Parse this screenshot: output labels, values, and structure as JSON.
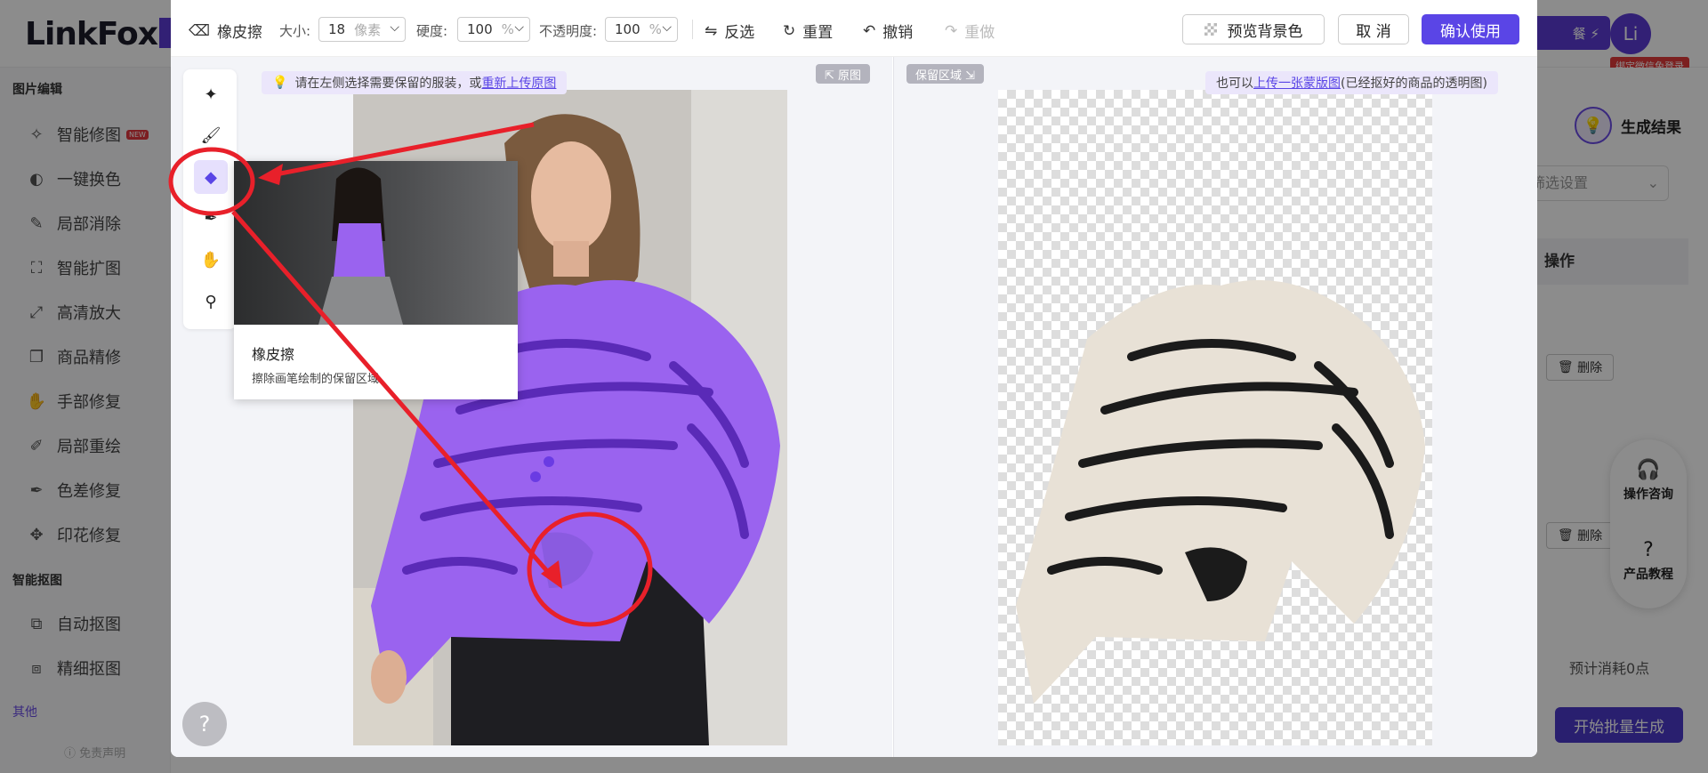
{
  "app": {
    "logo_text": "LinkFox"
  },
  "sidebar": {
    "sections": [
      {
        "title": "图片编辑",
        "items": [
          {
            "label": "智能修图",
            "icon": "magic-wand-icon",
            "badge": "NEW"
          },
          {
            "label": "一键换色",
            "icon": "color-swap-icon"
          },
          {
            "label": "局部消除",
            "icon": "eraser-icon"
          },
          {
            "label": "智能扩图",
            "icon": "expand-icon"
          },
          {
            "label": "高清放大",
            "icon": "upscale-icon"
          },
          {
            "label": "商品精修",
            "icon": "refine-icon"
          },
          {
            "label": "手部修复",
            "icon": "hand-icon"
          },
          {
            "label": "局部重绘",
            "icon": "redraw-icon"
          },
          {
            "label": "色差修复",
            "icon": "color-fix-icon"
          },
          {
            "label": "印花修复",
            "icon": "print-fix-icon"
          }
        ]
      },
      {
        "title": "智能抠图",
        "items": [
          {
            "label": "自动抠图",
            "icon": "auto-cutout-icon"
          },
          {
            "label": "精细抠图",
            "icon": "fine-cutout-icon"
          }
        ]
      },
      {
        "title": "其他",
        "items": []
      }
    ],
    "free_note": "免责声明"
  },
  "header": {
    "package_label": "餐 ⚡",
    "avatar_initial": "Li",
    "bind_tag": "绑定微信免登录"
  },
  "right_panel": {
    "gen_title": "生成结果",
    "filter_placeholder": "筛选设置",
    "op_header": "操作",
    "delete_label": "删除",
    "estimate": "预计消耗0点",
    "batch_button": "开始批量生成",
    "float": {
      "consult": "操作咨询",
      "tutorial": "产品教程"
    }
  },
  "modal": {
    "toolbar": {
      "tool_name": "橡皮擦",
      "size_label": "大小:",
      "size_value": "18",
      "size_unit": "像素",
      "hardness_label": "硬度:",
      "hardness_value": "100",
      "hardness_unit": "%",
      "opacity_label": "不透明度:",
      "opacity_value": "100",
      "opacity_unit": "%",
      "invert": "反选",
      "reset": "重置",
      "undo": "撤销",
      "redo": "重做",
      "preview_bg": "预览背景色",
      "cancel": "取 消",
      "confirm": "确认使用"
    },
    "hint_left": "请在左侧选择需要保留的服装，或 ",
    "hint_left_link": "重新上传原图",
    "hint_right": "也可以 ",
    "hint_right_link": "上传一张蒙版图",
    "hint_right_suffix": " (已经抠好的商品的透明图)",
    "orig_tag": "⇱ 原图",
    "keep_tag": "保留区域 ⇲",
    "tooltip": {
      "title": "橡皮擦",
      "desc": "擦除画笔绘制的保留区域"
    },
    "help": "?"
  },
  "colors": {
    "accent": "#5a45e6",
    "annotation_red": "#e8202a",
    "mask_purple": "#9a63ef"
  }
}
